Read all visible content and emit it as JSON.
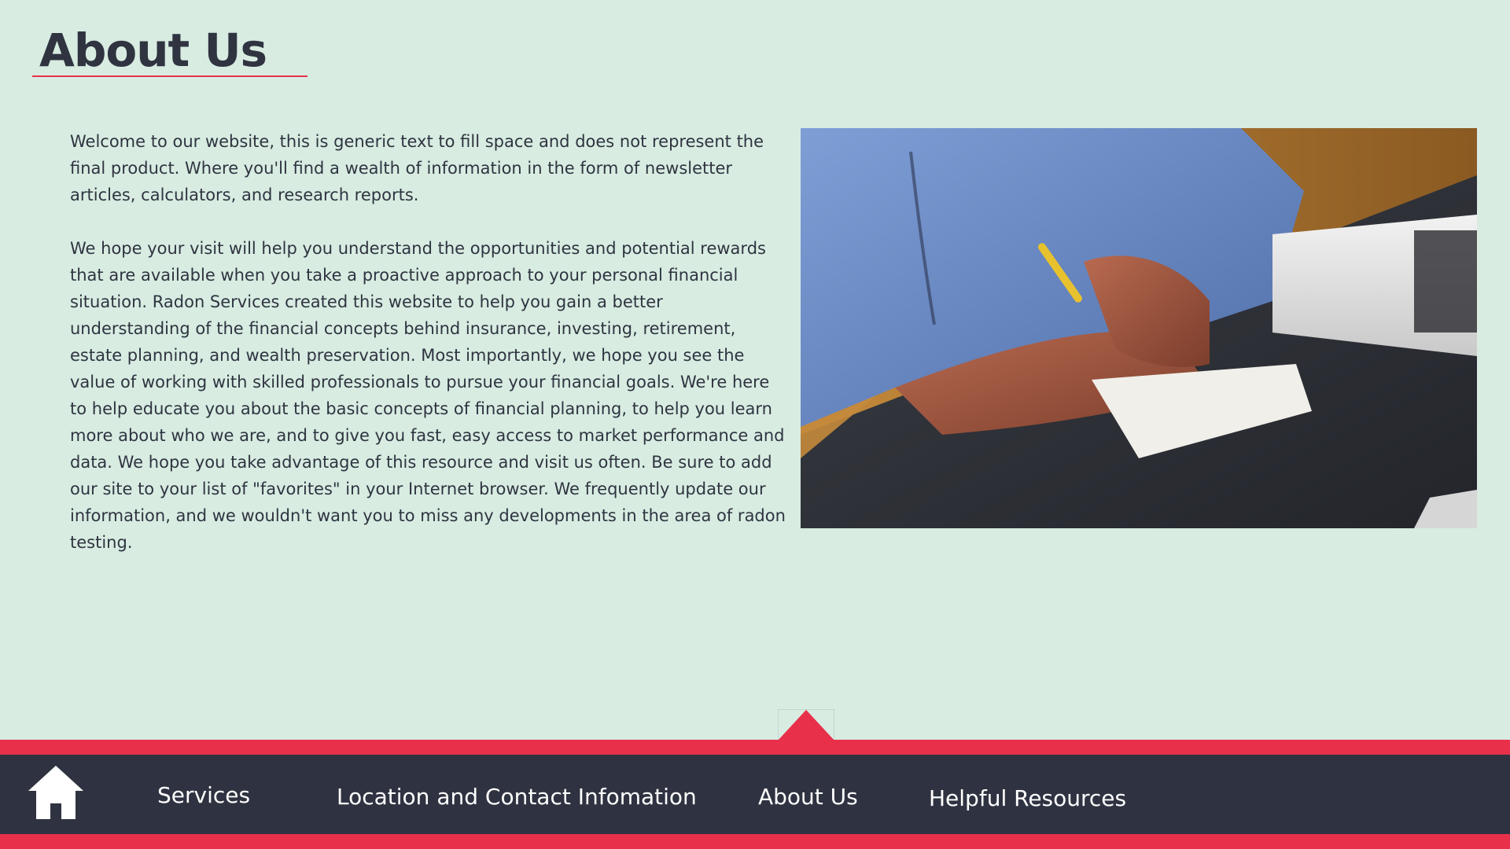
{
  "header": {
    "title": "About Us"
  },
  "content": {
    "paragraphs": [
      "Welcome to our website, this is generic text to fill space and does not represent the final product. Where you'll find a wealth of information in the form of newsletter articles, calculators, and research reports.",
      "We hope your visit will help you understand the opportunities and potential rewards that are available when you take a proactive approach to your personal financial situation. Radon Services created this website to help you gain a better understanding of the financial concepts behind insurance, investing, retirement, estate planning, and wealth preservation. Most importantly, we hope you see the value of working with skilled professionals to pursue your financial goals. We're here to help educate you about the basic concepts of financial planning, to help you learn more about who we are, and to give you fast, easy access to market performance and data. We hope you take advantage of this resource and visit us often. Be sure to add our site to your list of \"favorites\" in your Internet browser. We frequently update our information, and we wouldn't want you to miss any developments in the area of radon testing."
    ],
    "image_icon": "photo-person-writing-at-desk"
  },
  "footer": {
    "home_icon": "home-icon",
    "nav": {
      "services": "Services",
      "location": "Location and Contact Infomation",
      "about": "About Us",
      "resources": "Helpful Resources"
    },
    "scroll_top_icon": "up-triangle-icon"
  },
  "colors": {
    "background": "#d8ece2",
    "accent": "#e8304a",
    "nav_background": "#2f3341",
    "text": "#2f3440"
  }
}
